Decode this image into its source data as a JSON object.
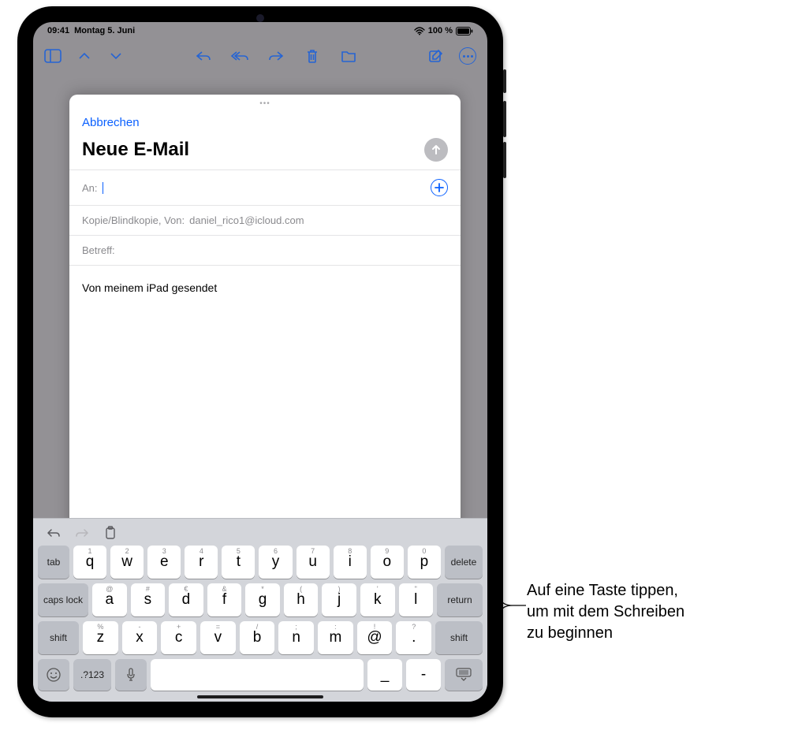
{
  "status": {
    "time": "09:41",
    "date": "Montag 5. Juni",
    "battery_pct": "100 %"
  },
  "compose": {
    "grabber": "•••",
    "cancel": "Abbrechen",
    "title": "Neue E-Mail",
    "to_label": "An:",
    "cc_label": "Kopie/Blindkopie, Von:",
    "from_email": "daniel_rico1@icloud.com",
    "subject_label": "Betreff:",
    "signature": "Von meinem iPad gesendet"
  },
  "keyboard": {
    "row1": [
      {
        "sub": "1",
        "main": "q"
      },
      {
        "sub": "2",
        "main": "w"
      },
      {
        "sub": "3",
        "main": "e"
      },
      {
        "sub": "4",
        "main": "r"
      },
      {
        "sub": "5",
        "main": "t"
      },
      {
        "sub": "6",
        "main": "y"
      },
      {
        "sub": "7",
        "main": "u"
      },
      {
        "sub": "8",
        "main": "i"
      },
      {
        "sub": "9",
        "main": "o"
      },
      {
        "sub": "0",
        "main": "p"
      }
    ],
    "row2": [
      {
        "sub": "@",
        "main": "a"
      },
      {
        "sub": "#",
        "main": "s"
      },
      {
        "sub": "€",
        "main": "d"
      },
      {
        "sub": "&",
        "main": "f"
      },
      {
        "sub": "*",
        "main": "g"
      },
      {
        "sub": "(",
        "main": "h"
      },
      {
        "sub": ")",
        "main": "j"
      },
      {
        "sub": "'",
        "main": "k"
      },
      {
        "sub": "\"",
        "main": "l"
      }
    ],
    "row3": [
      {
        "sub": "%",
        "main": "z"
      },
      {
        "sub": "-",
        "main": "x"
      },
      {
        "sub": "+",
        "main": "c"
      },
      {
        "sub": "=",
        "main": "v"
      },
      {
        "sub": "/",
        "main": "b"
      },
      {
        "sub": ";",
        "main": "n"
      },
      {
        "sub": ":",
        "main": "m"
      },
      {
        "sub": "!",
        "main": "@"
      },
      {
        "sub": "?",
        "main": "."
      }
    ],
    "tab": "tab",
    "delete": "delete",
    "caps": "caps lock",
    "return": "return",
    "shift_left": "shift",
    "shift_right": "shift",
    "numbers": ".?123",
    "underscore": "_",
    "dash": "-"
  },
  "callout": {
    "line1": "Auf eine Taste tippen,",
    "line2": "um mit dem Schreiben",
    "line3": "zu beginnen"
  }
}
